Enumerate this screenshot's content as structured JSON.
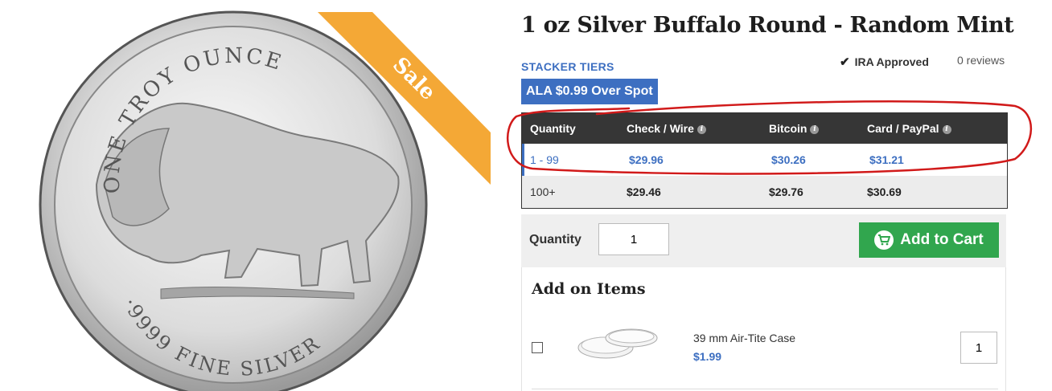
{
  "product": {
    "title": "1 oz Silver Buffalo Round - Random Mint",
    "sale_badge": "Sale",
    "coin_text_top": "ONE TROY OUNCE",
    "coin_text_bottom": "·9999 FINE SILVER"
  },
  "meta": {
    "stacker_tiers": "STACKER TIERS",
    "ira": "IRA Approved",
    "reviews": "0 reviews",
    "tier_pill": "ALA $0.99 Over Spot"
  },
  "price_table": {
    "headers": [
      "Quantity",
      "Check / Wire",
      "Bitcoin",
      "Card / PayPal"
    ],
    "rows": [
      [
        "1 - 99",
        "$29.96",
        "$30.26",
        "$31.21"
      ],
      [
        "100+",
        "$29.46",
        "$29.76",
        "$30.69"
      ]
    ]
  },
  "cart": {
    "quantity_label": "Quantity",
    "quantity_value": "1",
    "add_to_cart": "Add to Cart"
  },
  "addons": {
    "title": "Add on Items",
    "items": [
      {
        "name": "39 mm Air-Tite Case",
        "price": "$1.99",
        "qty": "1"
      }
    ]
  },
  "colors": {
    "accent_blue": "#3d6fc1",
    "cart_green": "#31a64e",
    "sale_orange": "#f4a836",
    "annotation_red": "#d11a1a"
  }
}
